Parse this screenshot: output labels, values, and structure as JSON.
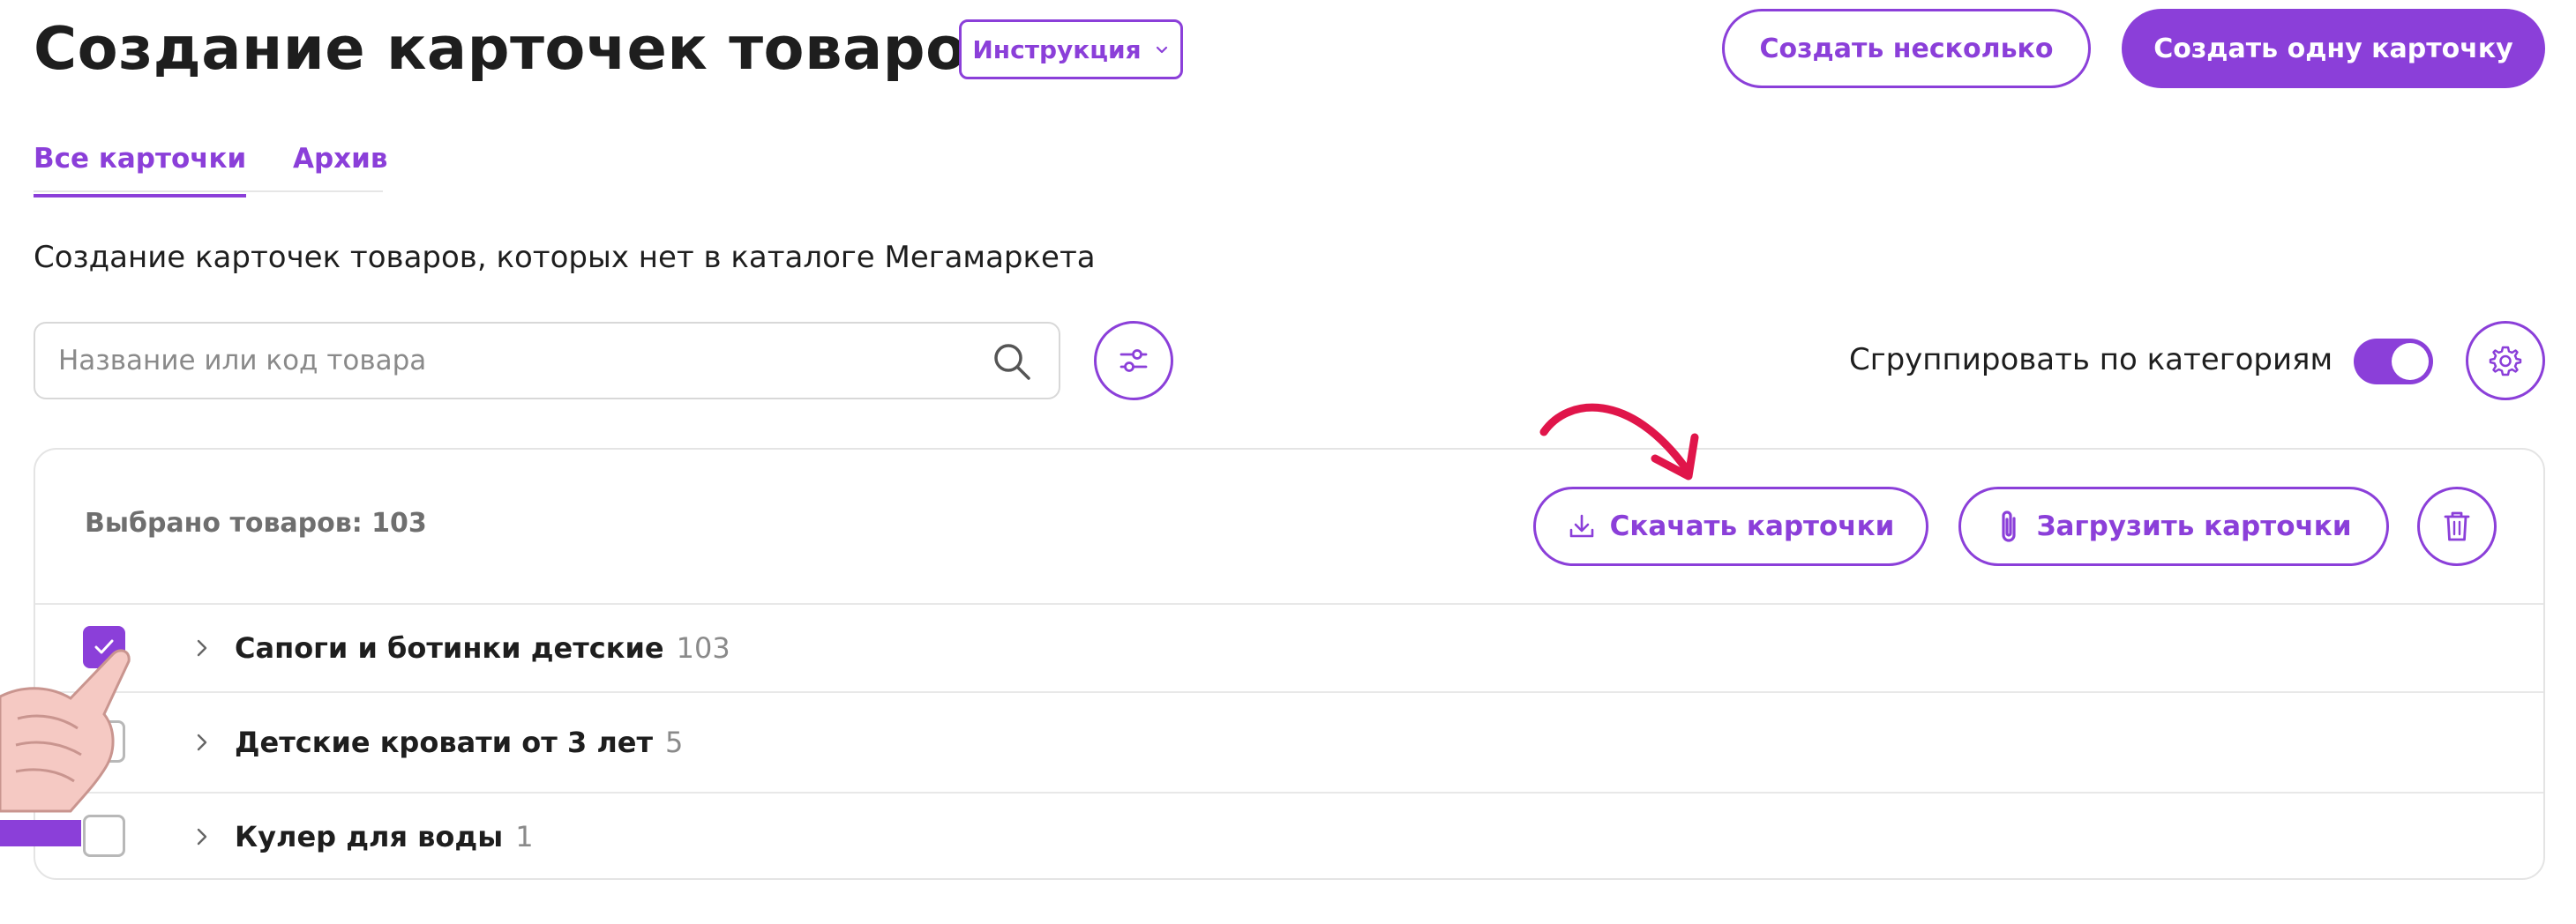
{
  "header": {
    "title": "Создание карточек товаров",
    "instruction_label": "Инструкция",
    "create_multiple_label": "Создать несколько",
    "create_one_label": "Создать одну карточку"
  },
  "tabs": [
    {
      "label": "Все карточки",
      "active": true
    },
    {
      "label": "Архив",
      "active": false
    }
  ],
  "subtitle": "Создание карточек товаров, которых нет в каталоге Мегамаркета",
  "search": {
    "placeholder": "Название или код товара",
    "value": ""
  },
  "grouping": {
    "label": "Сгруппировать по категориям",
    "enabled": true
  },
  "panel": {
    "selected_text": "Выбрано товаров: 103",
    "download_label": "Скачать карточки",
    "upload_label": "Загрузить карточки",
    "categories": [
      {
        "name": "Сапоги и ботинки детские",
        "count": "103",
        "checked": true
      },
      {
        "name": "Детские кровати от 3 лет",
        "count": "5",
        "checked": false
      },
      {
        "name": "Кулер для воды",
        "count": "1",
        "checked": false
      }
    ]
  },
  "colors": {
    "accent": "#8b3fd9",
    "annotation_arrow": "#e0154a"
  },
  "icons": [
    "chevron-down-icon",
    "search-icon",
    "filter-icon",
    "toggle-switch",
    "gear-icon",
    "download-icon",
    "paperclip-icon",
    "trash-icon",
    "checkmark-icon",
    "chevron-right-icon"
  ]
}
